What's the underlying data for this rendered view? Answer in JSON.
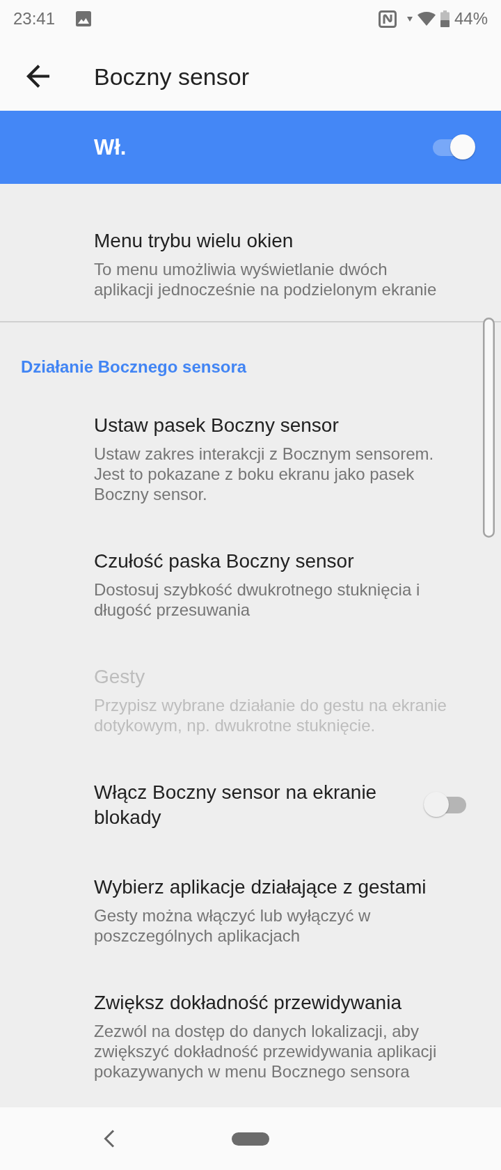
{
  "status_bar": {
    "time": "23:41",
    "battery": "44%"
  },
  "app_bar": {
    "title": "Boczny sensor"
  },
  "master_switch": {
    "label": "Wł.",
    "on": true
  },
  "preferences": [
    {
      "kind": "text",
      "title": "Menu trybu wielu okien",
      "description": "To menu umożliwia wyświetlanie dwóch\naplikacji jednocześnie na podzielonym ekranie",
      "disabled": false
    }
  ],
  "section": {
    "header": "Działanie Bocznego sensora",
    "items": [
      {
        "kind": "text",
        "title": "Ustaw pasek Boczny sensor",
        "description": "Ustaw zakres interakcji z Bocznym sensorem.\nJest to pokazane z boku ekranu jako pasek\nBoczny sensor.",
        "disabled": false
      },
      {
        "kind": "text",
        "title": "Czułość paska Boczny sensor",
        "description": "Dostosuj szybkość dwukrotnego stuknięcia i\ndługość przesuwania",
        "disabled": false
      },
      {
        "kind": "text",
        "title": "Gesty",
        "description": "Przypisz wybrane działanie do gestu na ekranie\ndotykowym, np. dwukrotne stuknięcie.",
        "disabled": true
      },
      {
        "kind": "switch",
        "title": "Włącz Boczny sensor na ekranie\nblokady",
        "on": false,
        "disabled": false
      },
      {
        "kind": "text",
        "title": "Wybierz aplikacje działające z gestami",
        "description": "Gesty można włączyć lub wyłączyć w\nposzczególnych aplikacjach",
        "disabled": false
      },
      {
        "kind": "text",
        "title": "Zwiększ dokładność przewidywania",
        "description": "Zezwól na dostęp do danych lokalizacji, aby\nzwiększyć dokładność przewidywania aplikacji\npokazywanych w menu Bocznego sensora",
        "disabled": false
      }
    ]
  }
}
